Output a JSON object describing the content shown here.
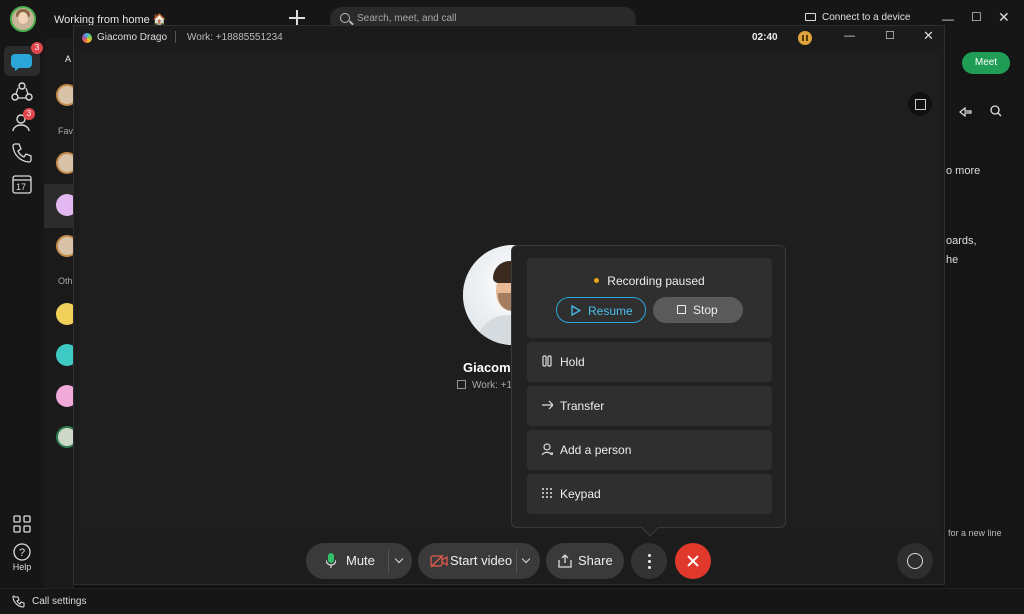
{
  "app": {
    "status_text": "Working from home 🏠",
    "search_placeholder": "Search, meet, and call",
    "connect_label": "Connect to a device",
    "badges": {
      "messaging": "3",
      "contacts": "3"
    },
    "calendar_day": "17",
    "help_label": "Help",
    "call_settings_label": "Call settings",
    "meet_label": "Meet",
    "right_panel": {
      "line1": "o more",
      "line2": "oards,",
      "line3": "he",
      "footer": "for a new line"
    },
    "list_strip": {
      "tab_label": "A",
      "fav_label": "Fav",
      "oth_label": "Oth"
    }
  },
  "call": {
    "caller_name": "Giacomo Drago",
    "caller_work": "Work: +18885551234",
    "timer": "02:40",
    "stage_name": "Giacomo",
    "stage_sub": "Work: +1"
  },
  "controls": {
    "mute_label": "Mute",
    "start_video_label": "Start video",
    "share_label": "Share"
  },
  "popover": {
    "recording_status": "Recording paused",
    "resume_label": "Resume",
    "stop_label": "Stop",
    "items": [
      {
        "label": "Hold",
        "icon": "pause-icon"
      },
      {
        "label": "Transfer",
        "icon": "arrow-right-icon"
      },
      {
        "label": "Add a person",
        "icon": "add-person-icon"
      },
      {
        "label": "Keypad",
        "icon": "keypad-icon"
      }
    ]
  },
  "colors": {
    "accent": "#2aa7d8",
    "end_call": "#e0392b",
    "meet": "#1f9d55",
    "badge": "#e0474c",
    "recording_dot": "#e8a317"
  }
}
